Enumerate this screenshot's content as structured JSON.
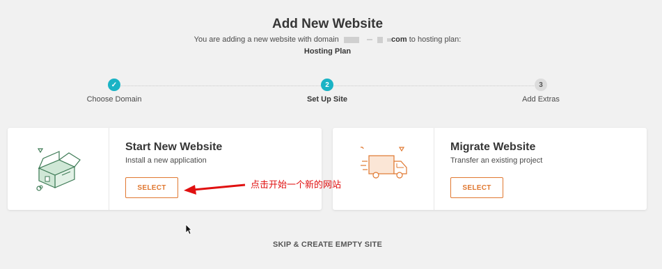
{
  "header": {
    "title": "Add New Website",
    "subtitle_prefix": "You are adding a new website with domain",
    "domain_suffix": "com",
    "subtitle_suffix": "to hosting plan:",
    "plan": "Hosting Plan"
  },
  "steps": [
    {
      "label": "Choose Domain",
      "marker": "✓",
      "state": "done"
    },
    {
      "label": "Set Up Site",
      "marker": "2",
      "state": "active"
    },
    {
      "label": "Add Extras",
      "marker": "3",
      "state": "pending"
    }
  ],
  "cards": [
    {
      "title": "Start New Website",
      "description": "Install a new application",
      "button": "SELECT",
      "icon": "house-box-icon"
    },
    {
      "title": "Migrate Website",
      "description": "Transfer an existing project",
      "button": "SELECT",
      "icon": "moving-truck-icon"
    }
  ],
  "annotation": "点击开始一个新的网站",
  "skip_label": "SKIP & CREATE EMPTY SITE",
  "colors": {
    "accent": "#e0772f",
    "step_active": "#1ab3c5",
    "step_pending": "#dcdcdc",
    "illustration_green": "#3d7a55",
    "annotation_red": "#e01010"
  }
}
